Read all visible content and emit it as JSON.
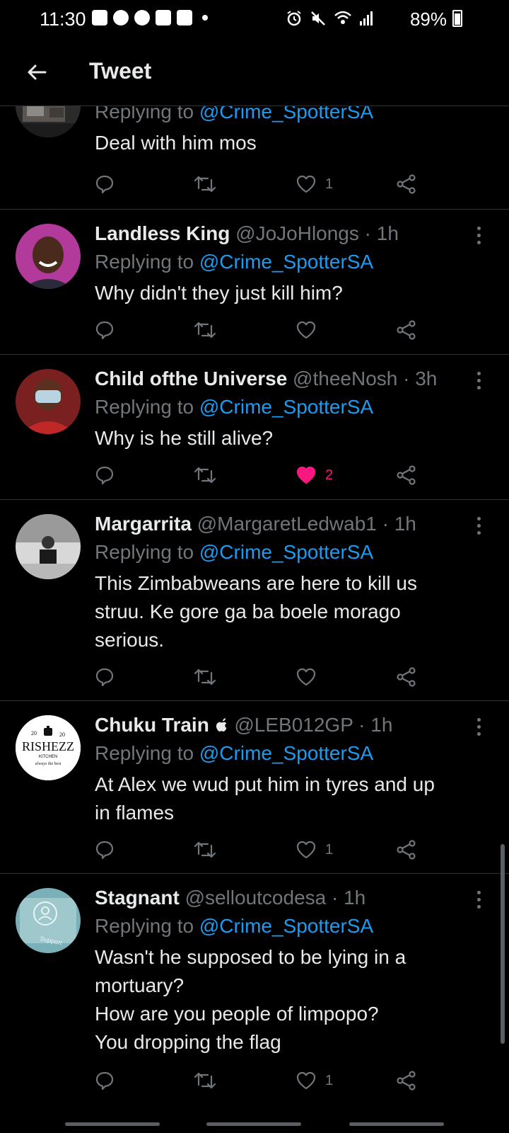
{
  "status_bar": {
    "time": "11:30",
    "battery": "89%",
    "notification_icons": [
      "message-icon",
      "facebook-icon",
      "facebook-icon",
      "download-icon",
      "download-icon"
    ],
    "system_icons": [
      "alarm-icon",
      "mute-icon",
      "wifi-icon",
      "signal-icon"
    ]
  },
  "header": {
    "title": "Tweet",
    "back_icon": "back-arrow-icon"
  },
  "colors": {
    "background": "#000000",
    "mention": "#1d9bf0",
    "muted": "#71767b",
    "like_active": "#f91880",
    "divider": "#2f3336"
  },
  "tweets": [
    {
      "name": "",
      "handle": "",
      "time": "",
      "replying_prefix": "Replying to",
      "replying_to": "@Crime_SpotterSA",
      "text_lines": [
        "Deal with him mos"
      ],
      "likes": "1",
      "liked": false
    },
    {
      "name": "Landless King",
      "handle": "@JoJoHlongs",
      "time": "1h",
      "replying_prefix": "Replying to",
      "replying_to": "@Crime_SpotterSA",
      "text_lines": [
        "Why didn't they just kill him?"
      ],
      "likes": "",
      "liked": false
    },
    {
      "name": "Child ofthe Universe",
      "handle": "@theeNosh",
      "time": "3h",
      "replying_prefix": "Replying to",
      "replying_to": "@Crime_SpotterSA",
      "text_lines": [
        "Why is he still alive?"
      ],
      "likes": "2",
      "liked": true
    },
    {
      "name": "Margarrita",
      "handle": "@MargaretLedwab1",
      "time": "1h",
      "replying_prefix": "Replying to",
      "replying_to": "@Crime_SpotterSA",
      "text_lines": [
        "This Zimbabweans are here to kill us",
        "struu.  Ke gore ga ba boele morago",
        "serious."
      ],
      "likes": "",
      "liked": false
    },
    {
      "name": "Chuku Train",
      "handle": "@LEB012GP",
      "time": "1h",
      "replying_prefix": "Replying to",
      "replying_to": "@Crime_SpotterSA",
      "text_lines": [
        "At Alex we wud put him in tyres and up",
        "in flames"
      ],
      "likes": "1",
      "liked": false,
      "avatar_logo": {
        "year_left": "20",
        "year_right": "20",
        "brand": "RISHEZZ",
        "sub": "KITCHEN",
        "tagline": "always the best"
      }
    },
    {
      "name": "Stagnant",
      "handle": "@selloutcodesa",
      "time": "1h",
      "replying_prefix": "Replying to",
      "replying_to": "@Crime_SpotterSA",
      "text_lines": [
        "Wasn't he supposed to be lying in a",
        "mortuary?",
        "How are you people of limpopo?",
        "You dropping the flag"
      ],
      "likes": "1",
      "liked": false,
      "avatar_text": "Support"
    }
  ]
}
